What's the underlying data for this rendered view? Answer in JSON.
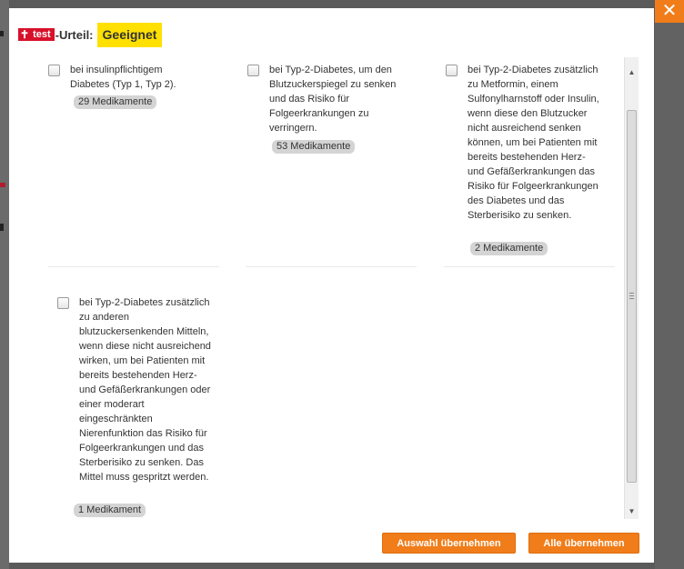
{
  "header": {
    "logo_text": "test",
    "urteil_label": "-Urteil:",
    "verdict": "Geeignet"
  },
  "options": [
    {
      "text": "bei insulinpflichtigem Diabetes (Typ 1, Typ 2).",
      "count": "29 Medikamente",
      "checked": false
    },
    {
      "text": "bei Typ-2-Diabetes, um den Blutzuckerspiegel zu senken und das Risiko für Folgeerkrankungen zu verringern.",
      "count": "53 Medikamente",
      "checked": false
    },
    {
      "text": "bei Typ-2-Diabetes zusätzlich zu Metformin, einem Sulfonylharnstoff oder Insulin, wenn diese den Blutzucker nicht ausreichend senken können, um bei Patienten mit bereits bestehenden Herz- und Gefäßerkrankungen das Risiko für Folgeerkrankungen des Diabetes und das Sterberisiko zu senken.",
      "count": "2 Medikamente",
      "checked": false
    },
    {
      "text": "bei Typ-2-Diabetes zusätzlich zu anderen blutzuckersenkenden Mitteln, wenn diese nicht ausreichend wirken, um bei Patienten mit bereits bestehenden Herz- und Gefäßerkrankungen oder einer moderart eingeschränkten Nierenfunktion das Risiko für Folgeerkrankungen und das Sterberisiko zu senken. Das Mittel muss gespritzt werden.",
      "count": "1 Medikament",
      "checked": false
    }
  ],
  "buttons": {
    "apply_selection": "Auswahl übernehmen",
    "apply_all": "Alle übernehmen"
  },
  "close_symbol": "✕",
  "colors": {
    "accent_orange": "#f07d1a",
    "verdict_yellow": "#ffe000",
    "logo_red": "#d8112b",
    "badge_gray": "#d4d4d4"
  },
  "icons": [
    "close-icon",
    "scroll-up-icon",
    "scroll-down-icon",
    "checkbox"
  ]
}
